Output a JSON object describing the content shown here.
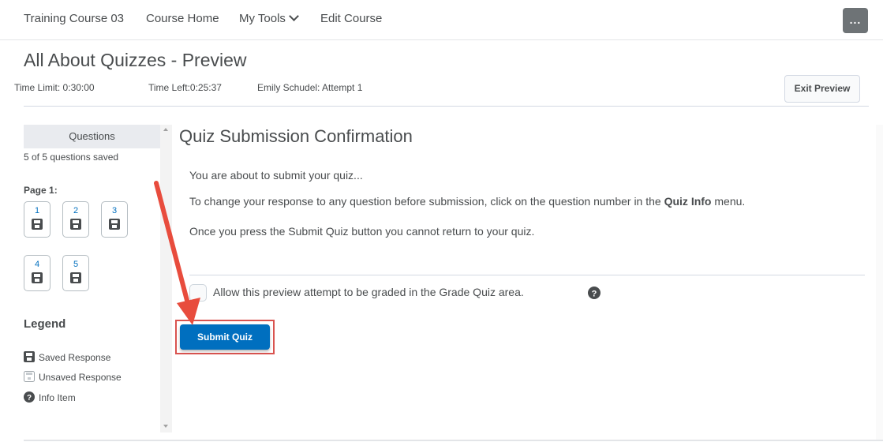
{
  "topnav": {
    "course_name": "Training Course 03",
    "course_home": "Course Home",
    "my_tools": "My Tools",
    "edit_course": "Edit Course",
    "more_label": "..."
  },
  "header": {
    "title": "All About Quizzes - Preview",
    "time_limit": "Time Limit: 0:30:00",
    "time_left": "Time Left:0:25:37",
    "attempt": "Emily Schudel: Attempt 1",
    "exit_button": "Exit Preview"
  },
  "sidebar": {
    "heading": "Questions",
    "saved_count": "5 of 5 questions saved",
    "page_label": "Page 1:",
    "questions": [
      "1",
      "2",
      "3",
      "4",
      "5"
    ],
    "legend_title": "Legend",
    "legend": [
      {
        "label": "Saved Response",
        "icon": "saved-response-icon"
      },
      {
        "label": "Unsaved Response",
        "icon": "unsaved-response-icon"
      },
      {
        "label": "Info Item",
        "icon": "info-item-icon"
      }
    ]
  },
  "main": {
    "title": "Quiz Submission Confirmation",
    "line1": "You are about to submit your quiz...",
    "line2_pre": "To change your response to any question before submission, click on the question number in the ",
    "line2_bold": "Quiz Info",
    "line2_post": " menu.",
    "line3": "Once you press the Submit Quiz button you cannot return to your quiz.",
    "allow_label": "Allow this preview attempt to be graded in the Grade Quiz area.",
    "allow_checked": false,
    "submit_button": "Submit Quiz"
  },
  "colors": {
    "accent": "#006fbf",
    "highlight": "#d9534f",
    "arrow": "#e84c3d"
  }
}
